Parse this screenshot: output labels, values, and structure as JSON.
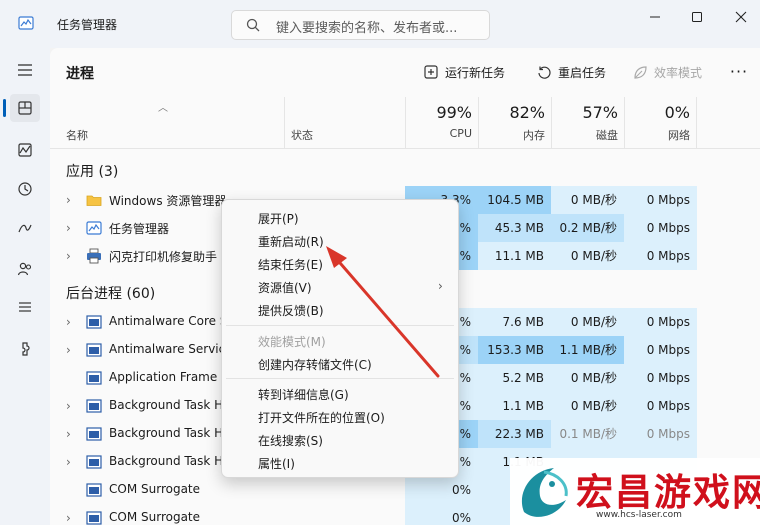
{
  "window": {
    "title": "任务管理器"
  },
  "search": {
    "placeholder": "键入要搜索的名称、发布者或..."
  },
  "page": {
    "title": "进程"
  },
  "toolbar": {
    "run_new_task": "运行新任务",
    "restart_task": "重启任务",
    "efficiency_mode": "效率模式",
    "more": "···"
  },
  "columns": {
    "name": "名称",
    "status": "状态",
    "cpu": {
      "pct": "99%",
      "label": "CPU"
    },
    "mem": {
      "pct": "82%",
      "label": "内存"
    },
    "disk": {
      "pct": "57%",
      "label": "磁盘"
    },
    "net": {
      "pct": "0%",
      "label": "网络"
    }
  },
  "sections": {
    "apps": "应用 (3)",
    "background": "后台进程 (60)"
  },
  "apps": [
    {
      "name": "Windows 资源管理器",
      "icon": "folder-icon",
      "cpu": "3.3%",
      "mem": "104.5 MB",
      "disk": "0 MB/秒",
      "net": "0 Mbps"
    },
    {
      "name": "任务管理器",
      "icon": "task-manager-icon",
      "cpu": "%",
      "mem": "45.3 MB",
      "disk": "0.2 MB/秒",
      "net": "0 Mbps"
    },
    {
      "name": "闪克打印机修复助手",
      "icon": "printer-icon",
      "cpu": "%",
      "mem": "11.1 MB",
      "disk": "0 MB/秒",
      "net": "0 Mbps"
    }
  ],
  "background": [
    {
      "name": "Antimalware Core S",
      "cpu": "%",
      "mem": "7.6 MB",
      "disk": "0 MB/秒",
      "net": "0 Mbps"
    },
    {
      "name": "Antimalware Service",
      "cpu": "%",
      "mem": "153.3 MB",
      "disk": "1.1 MB/秒",
      "net": "0 Mbps"
    },
    {
      "name": "Application Frame H",
      "cpu": "%",
      "mem": "5.2 MB",
      "disk": "0 MB/秒",
      "net": "0 Mbps"
    },
    {
      "name": "Background Task H",
      "cpu": "%",
      "mem": "1.1 MB",
      "disk": "0 MB/秒",
      "net": "0 Mbps"
    },
    {
      "name": "Background Task H",
      "cpu": "%",
      "mem": "22.3 MB",
      "disk": "0.1 MB/秒",
      "net": "0 Mbps"
    },
    {
      "name": "Background Task H",
      "cpu": "%",
      "mem": "1.1 MB",
      "disk": "",
      "net": ""
    },
    {
      "name": "COM Surrogate",
      "cpu": "0%",
      "mem": "",
      "disk": "",
      "net": ""
    },
    {
      "name": "COM Surrogate",
      "cpu": "0%",
      "mem": "",
      "disk": "",
      "net": ""
    }
  ],
  "context_menu": {
    "expand": "展开(P)",
    "restart": "重新启动(R)",
    "end_task": "结束任务(E)",
    "resource_values": "资源值(V)",
    "feedback": "提供反馈(B)",
    "efficiency": "效能模式(M)",
    "dump": "创建内存转储文件(C)",
    "details": "转到详细信息(G)",
    "open_location": "打开文件所在的位置(O)",
    "search_online": "在线搜索(S)",
    "properties": "属性(I)"
  },
  "watermark": {
    "text": "宏昌游戏网",
    "url": "www.hcs-laser.com"
  },
  "colors": {
    "accent": "#005fb8",
    "heat_high": "#9cd3f7",
    "heat_mid": "#bfe3fa",
    "heat_low": "#dcf0fc",
    "arrow": "#d9362a"
  }
}
